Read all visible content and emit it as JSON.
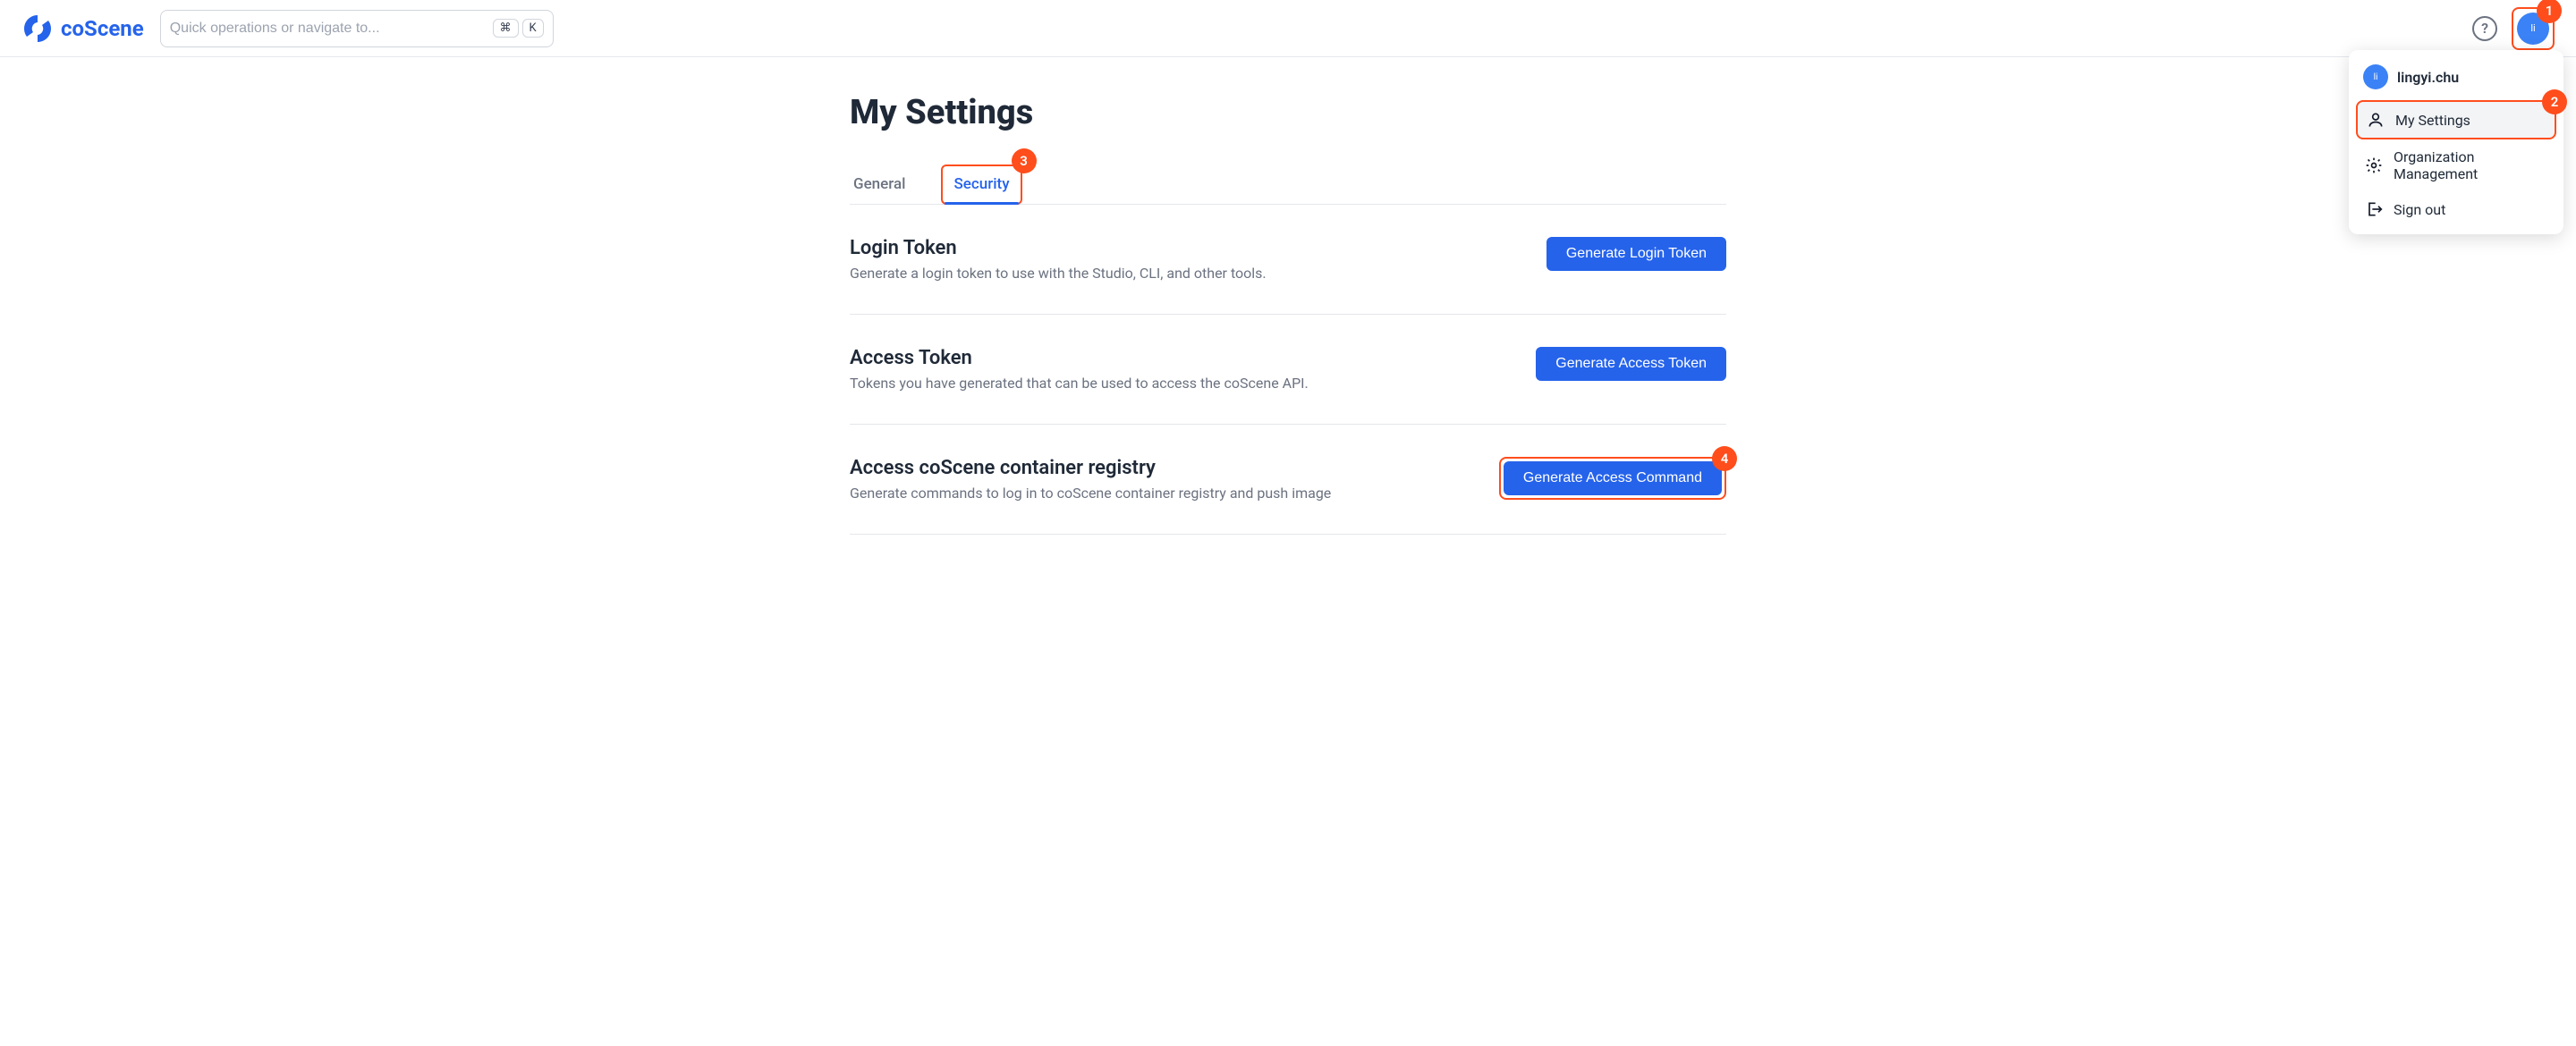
{
  "brand": {
    "name": "coScene"
  },
  "search": {
    "placeholder": "Quick operations or navigate to...",
    "kbd1": "⌘",
    "kbd2": "K"
  },
  "topbar": {
    "help_symbol": "?",
    "avatar_initials": "li"
  },
  "callouts": {
    "c1": "1",
    "c2": "2",
    "c3": "3",
    "c4": "4"
  },
  "dropdown": {
    "avatar_initials": "li",
    "username": "lingyi.chu",
    "items": [
      {
        "label": "My Settings",
        "highlighted": true
      },
      {
        "label": "Organization Management",
        "highlighted": false
      },
      {
        "label": "Sign out",
        "highlighted": false
      }
    ]
  },
  "page": {
    "title": "My Settings"
  },
  "tabs": [
    {
      "label": "General",
      "active": false
    },
    {
      "label": "Security",
      "active": true
    }
  ],
  "sections": [
    {
      "title": "Login Token",
      "desc": "Generate a login token to use with the Studio, CLI, and other tools.",
      "button": "Generate Login Token",
      "highlighted": false
    },
    {
      "title": "Access Token",
      "desc": "Tokens you have generated that can be used to access the coScene API.",
      "button": "Generate Access Token",
      "highlighted": false
    },
    {
      "title": "Access coScene container registry",
      "desc": "Generate commands to log in to coScene container registry and push image",
      "button": "Generate Access Command",
      "highlighted": true
    }
  ]
}
